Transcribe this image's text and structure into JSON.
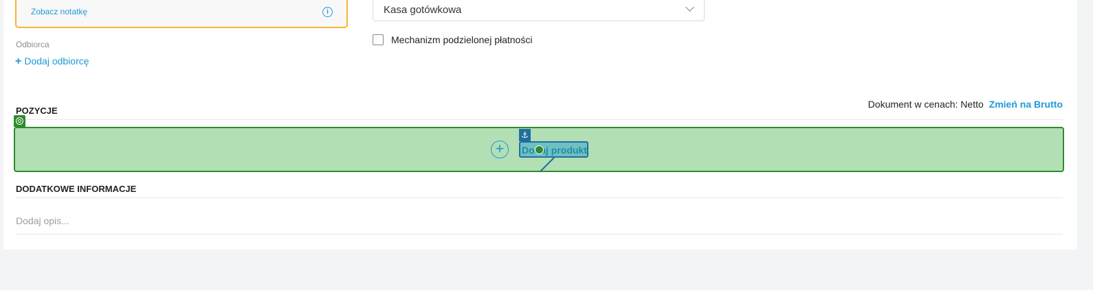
{
  "note": {
    "link_label": "Zobacz notatkę",
    "info_icon": "info-icon"
  },
  "payment": {
    "selected": "Kasa gotówkowa",
    "split_payment_label": "Mechanizm podzielonej płatności",
    "split_payment_checked": false
  },
  "recipient": {
    "label": "Odbiorca",
    "add_label": "Dodaj odbiorcę",
    "add_icon": "plus-icon"
  },
  "positions": {
    "title": "POZYCJE",
    "price_mode_label": "Dokument w cenach: Netto",
    "switch_label": "Zmień na Brutto",
    "add_product_label": "Dodaj produkt",
    "add_icon": "plus-circle-icon"
  },
  "additional": {
    "title": "DODATKOWE INFORMACJE",
    "description_placeholder": "Dodaj opis..."
  },
  "colors": {
    "accent": "#1d9ad6",
    "note_border": "#f5b731",
    "highlight": "#b3dfb5",
    "highlight_border": "#2e8b2e"
  }
}
